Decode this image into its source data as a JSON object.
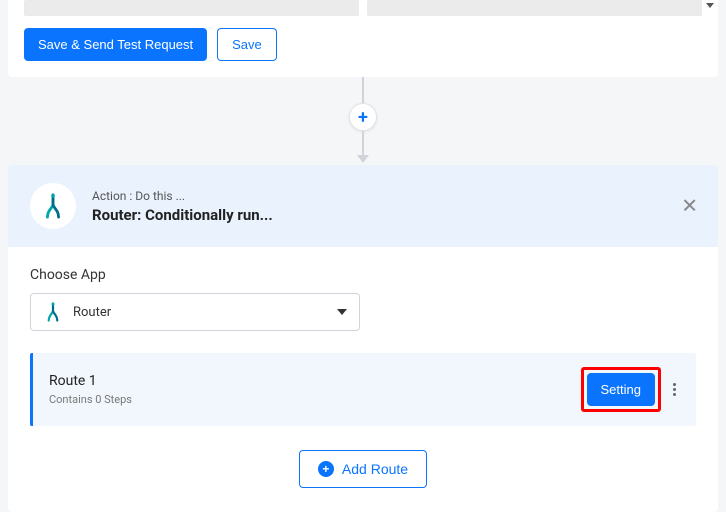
{
  "top": {
    "save_send_test": "Save & Send Test Request",
    "save": "Save"
  },
  "connector": {
    "plus": "+"
  },
  "action": {
    "subtitle": "Action : Do this ...",
    "title": "Router: Conditionally run..."
  },
  "choose_app": {
    "label": "Choose App",
    "selected": "Router"
  },
  "route": {
    "title": "Route 1",
    "sub": "Contains 0 Steps",
    "setting": "Setting"
  },
  "add_route": {
    "label": "Add Route",
    "plus": "+"
  }
}
